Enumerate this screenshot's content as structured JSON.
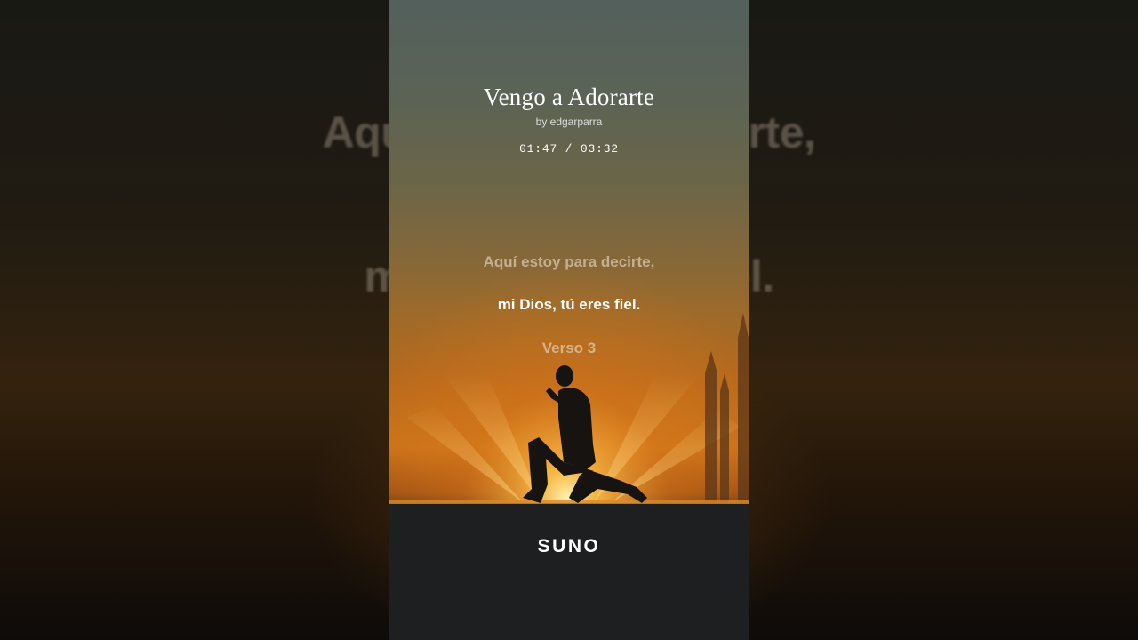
{
  "background_lyrics": {
    "line1": "Aquí estoy para decirte,",
    "line2": "mi Dios, tú eres fiel."
  },
  "song": {
    "title": "Vengo a Adorarte",
    "artist": "by edgarparra",
    "time": "01:47 / 03:32",
    "progress_fraction": 0.505
  },
  "lyrics": {
    "previous": "Aquí estoy para decirte,",
    "current": "mi Dios, tú eres fiel.",
    "next": "Verso 3"
  },
  "brand": {
    "name": "SUNO"
  },
  "colors": {
    "sunset_orange": "#c8731a",
    "sky_gray": "#53605c",
    "ground_dark": "#1c1d1f"
  }
}
